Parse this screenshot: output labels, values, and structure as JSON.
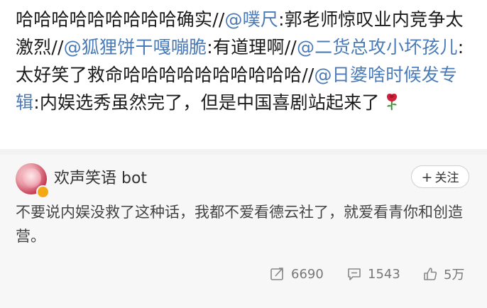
{
  "post": {
    "segments": [
      {
        "text": "哈哈哈哈哈哈哈哈哈确实//",
        "type": "text"
      },
      {
        "text": "@噗尺",
        "type": "mention"
      },
      {
        "text": ":郭老师惊叹业内竞争太激烈//",
        "type": "text"
      },
      {
        "text": "@狐狸饼干嘎嘣脆",
        "type": "mention"
      },
      {
        "text": ":有道理啊//",
        "type": "text"
      },
      {
        "text": "@二货总攻小坏孩儿",
        "type": "mention"
      },
      {
        "text": ":太好笑了救命哈哈哈哈哈哈哈哈哈哈//",
        "type": "text"
      },
      {
        "text": "@日婆啥时候发专辑",
        "type": "mention"
      },
      {
        "text": ":内娱选秀虽然完了，但是中国喜剧站起来了",
        "type": "text"
      }
    ],
    "emoji": "rose-icon"
  },
  "comment_card": {
    "username": "欢声笑语 bot",
    "follow_label": "关注",
    "text": "不要说内娱没救了这种话，我都不爱看德云社了，就爱看青你和创造营。",
    "stats": {
      "reposts": "6690",
      "comments": "1543",
      "likes": "5万"
    }
  },
  "colors": {
    "mention": "#4b7bb6",
    "card_background": "#f7f7f7",
    "divider": "#f2f2f2",
    "badge": "#f3a815"
  }
}
